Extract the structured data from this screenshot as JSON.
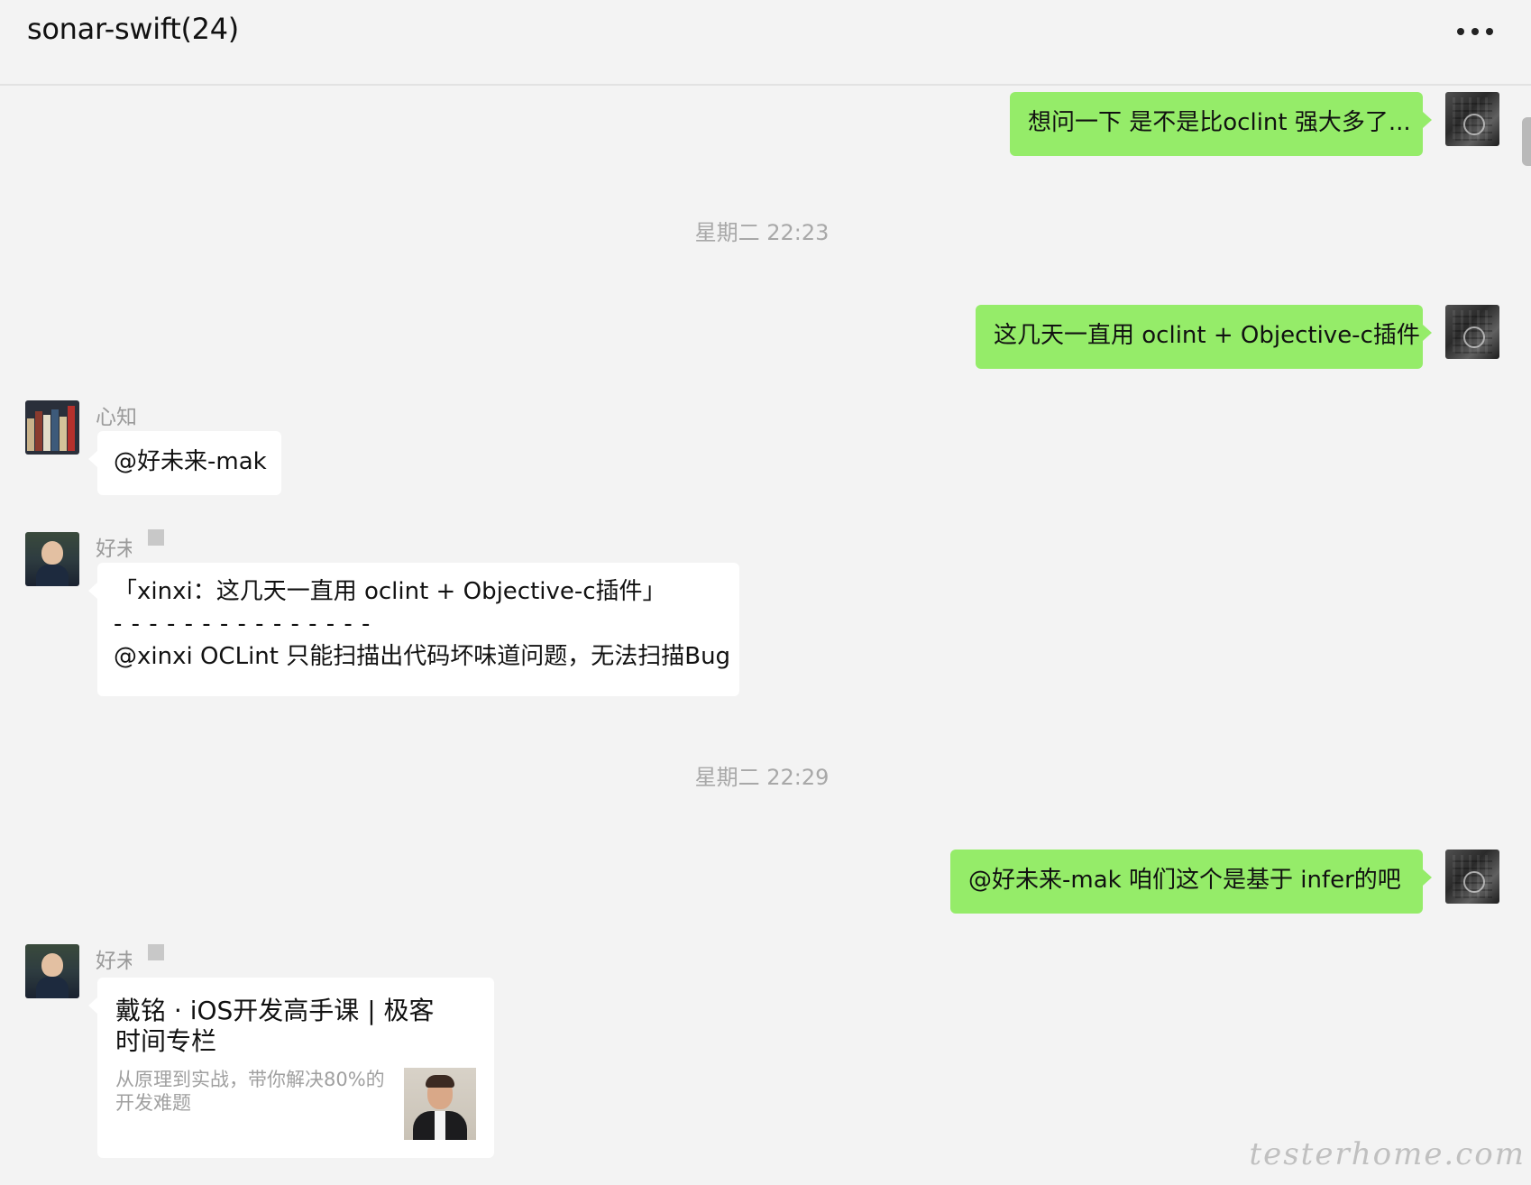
{
  "header": {
    "title": "sonar-swift(24)"
  },
  "messages": {
    "m1": {
      "text": "想问一下 是不是比oclint 强大多了..."
    },
    "time1": "星期二 22:23",
    "m2": {
      "text": "这几天一直用 oclint + Objective-c插件"
    },
    "m3": {
      "sender": "心知",
      "text": "@好未来-mak"
    },
    "m4": {
      "sender": "好未",
      "quote": "「xinxi：这几天一直用 oclint + Objective-c插件」",
      "divider": "- - - - - - - - - - - - - - -",
      "text": "@xinxi OCLint 只能扫描出代码坏味道问题，无法扫描Bug"
    },
    "time2": "星期二 22:29",
    "m5": {
      "text": "@好未来-mak   咱们这个是基于 infer的吧"
    },
    "m6": {
      "sender": "好未",
      "card_title": "戴铭 · iOS开发高手课 | 极客时间专栏",
      "card_desc": "从原理到实战，带你解决80%的开发难题"
    }
  },
  "watermark": "testerhome.com",
  "colors": {
    "self_bubble": "#95ec69",
    "other_bubble": "#ffffff",
    "background": "#f3f3f3"
  }
}
